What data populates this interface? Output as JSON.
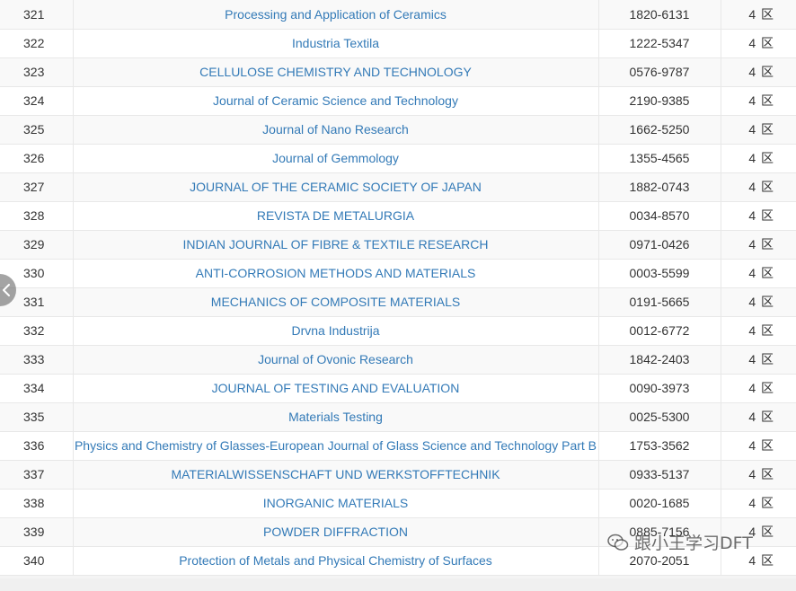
{
  "rows": [
    {
      "num": "321",
      "title": "Processing and Application of Ceramics",
      "issn": "1820-6131",
      "zone": "4 区"
    },
    {
      "num": "322",
      "title": "Industria Textila",
      "issn": "1222-5347",
      "zone": "4 区"
    },
    {
      "num": "323",
      "title": "CELLULOSE CHEMISTRY AND TECHNOLOGY",
      "issn": "0576-9787",
      "zone": "4 区"
    },
    {
      "num": "324",
      "title": "Journal of Ceramic Science and Technology",
      "issn": "2190-9385",
      "zone": "4 区"
    },
    {
      "num": "325",
      "title": "Journal of Nano Research",
      "issn": "1662-5250",
      "zone": "4 区"
    },
    {
      "num": "326",
      "title": "Journal of Gemmology",
      "issn": "1355-4565",
      "zone": "4 区"
    },
    {
      "num": "327",
      "title": "JOURNAL OF THE CERAMIC SOCIETY OF JAPAN",
      "issn": "1882-0743",
      "zone": "4 区"
    },
    {
      "num": "328",
      "title": "REVISTA DE METALURGIA",
      "issn": "0034-8570",
      "zone": "4 区"
    },
    {
      "num": "329",
      "title": "INDIAN JOURNAL OF FIBRE & TEXTILE RESEARCH",
      "issn": "0971-0426",
      "zone": "4 区"
    },
    {
      "num": "330",
      "title": "ANTI-CORROSION METHODS AND MATERIALS",
      "issn": "0003-5599",
      "zone": "4 区"
    },
    {
      "num": "331",
      "title": "MECHANICS OF COMPOSITE MATERIALS",
      "issn": "0191-5665",
      "zone": "4 区"
    },
    {
      "num": "332",
      "title": "Drvna Industrija",
      "issn": "0012-6772",
      "zone": "4 区"
    },
    {
      "num": "333",
      "title": "Journal of Ovonic Research",
      "issn": "1842-2403",
      "zone": "4 区"
    },
    {
      "num": "334",
      "title": "JOURNAL OF TESTING AND EVALUATION",
      "issn": "0090-3973",
      "zone": "4 区"
    },
    {
      "num": "335",
      "title": "Materials Testing",
      "issn": "0025-5300",
      "zone": "4 区"
    },
    {
      "num": "336",
      "title": "Physics and Chemistry of Glasses-European Journal of Glass Science and Technology Part B",
      "issn": "1753-3562",
      "zone": "4 区"
    },
    {
      "num": "337",
      "title": "MATERIALWISSENSCHAFT UND WERKSTOFFTECHNIK",
      "issn": "0933-5137",
      "zone": "4 区"
    },
    {
      "num": "338",
      "title": "INORGANIC MATERIALS",
      "issn": "0020-1685",
      "zone": "4 区"
    },
    {
      "num": "339",
      "title": "POWDER DIFFRACTION",
      "issn": "0885-7156",
      "zone": "4 区"
    },
    {
      "num": "340",
      "title": "Protection of Metals and Physical Chemistry of Surfaces",
      "issn": "2070-2051",
      "zone": "4 区"
    }
  ],
  "scroll_button": {
    "icon": "chevron-left-icon"
  },
  "watermark": {
    "text": "跟小王学习DFT",
    "icon": "wechat-icon"
  },
  "colors": {
    "link": "#337ab7",
    "row_odd": "#f9f9f9",
    "row_even": "#ffffff",
    "border": "#e8e8e8"
  }
}
